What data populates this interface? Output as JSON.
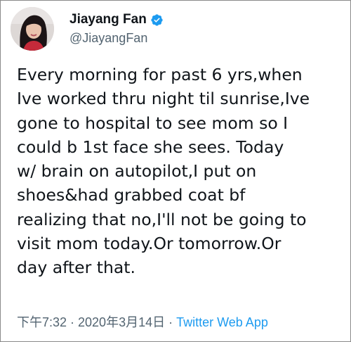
{
  "tweet": {
    "author": {
      "display_name": "Jiayang Fan",
      "handle": "@JiayangFan",
      "verified_icon": "verified-badge-icon",
      "avatar_icon": "profile-photo"
    },
    "text_lines": [
      "Every morning for past 6 yrs,when",
      "Ive worked thru night til sunrise,Ive",
      "gone to hospital to see mom so I",
      "could b 1st face she sees. Today",
      "w/ brain on autopilot,I put on",
      "shoes&had grabbed coat bf",
      "realizing that no,I'll not be going to",
      "visit mom today.Or tomorrow.Or",
      "day after that."
    ],
    "timestamp": "下午7:32 · 2020年3月14日",
    "separator": "·",
    "source": "Twitter Web App"
  },
  "colors": {
    "text": "#0f1419",
    "secondary": "#536471",
    "accent": "#1d9bf0",
    "border": "#8a8a8a"
  }
}
